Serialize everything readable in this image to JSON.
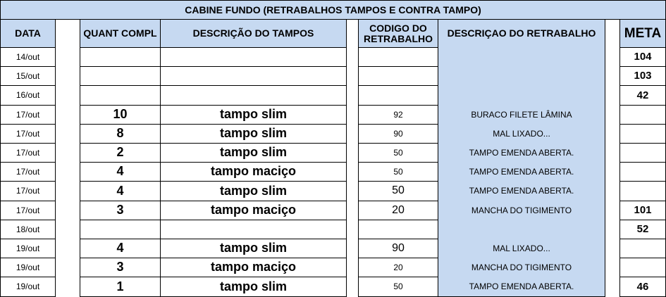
{
  "title": "CABINE FUNDO (RETRABALHOS TAMPOS E CONTRA TAMPO)",
  "headers": {
    "data": "DATA",
    "quant": "QUANT COMPL",
    "descricao_tampos": "DESCRIÇÃO DO TAMPOS",
    "codigo": "CODIGO DO RETRABALHO",
    "descricao_retrabalho": "DESCRIÇAO DO RETRABALHO",
    "meta": "META"
  },
  "colors": {
    "header_fill": "#c6d9f1",
    "grid": "#000000"
  },
  "rows": [
    {
      "data": "14/out",
      "quant": "",
      "tampo": "",
      "codigo": "",
      "retrabalho": "",
      "meta": "104"
    },
    {
      "data": "15/out",
      "quant": "",
      "tampo": "",
      "codigo": "",
      "retrabalho": "",
      "meta": "103"
    },
    {
      "data": "16/out",
      "quant": "",
      "tampo": "",
      "codigo": "",
      "retrabalho": "",
      "meta": "42"
    },
    {
      "data": "17/out",
      "quant": "10",
      "tampo": "tampo slim",
      "codigo": "92",
      "retrabalho": "BURACO FILETE LÂMINA",
      "meta": ""
    },
    {
      "data": "17/out",
      "quant": "8",
      "tampo": "tampo slim",
      "codigo": "90",
      "retrabalho": "MAL LIXADO...",
      "meta": ""
    },
    {
      "data": "17/out",
      "quant": "2",
      "tampo": "tampo slim",
      "codigo": "50",
      "retrabalho": "TAMPO EMENDA ABERTA.",
      "meta": ""
    },
    {
      "data": "17/out",
      "quant": "4",
      "tampo": "tampo maciço",
      "codigo": "50",
      "retrabalho": "TAMPO EMENDA ABERTA.",
      "meta": ""
    },
    {
      "data": "17/out",
      "quant": "4",
      "tampo": "tampo slim",
      "codigo": "50",
      "retrabalho": "TAMPO EMENDA ABERTA.",
      "meta": ""
    },
    {
      "data": "17/out",
      "quant": "3",
      "tampo": "tampo maciço",
      "codigo": "20",
      "retrabalho": "MANCHA DO TIGIMENTO",
      "meta": "101"
    },
    {
      "data": "18/out",
      "quant": "",
      "tampo": "",
      "codigo": "",
      "retrabalho": "",
      "meta": "52"
    },
    {
      "data": "19/out",
      "quant": "4",
      "tampo": "tampo slim",
      "codigo": "90",
      "retrabalho": "MAL LIXADO...",
      "meta": ""
    },
    {
      "data": "19/out",
      "quant": "3",
      "tampo": "tampo maciço",
      "codigo": "20",
      "retrabalho": "MANCHA DO TIGIMENTO",
      "meta": ""
    },
    {
      "data": "19/out",
      "quant": "1",
      "tampo": "tampo slim",
      "codigo": "50",
      "retrabalho": "TAMPO EMENDA ABERTA.",
      "meta": "46"
    }
  ]
}
